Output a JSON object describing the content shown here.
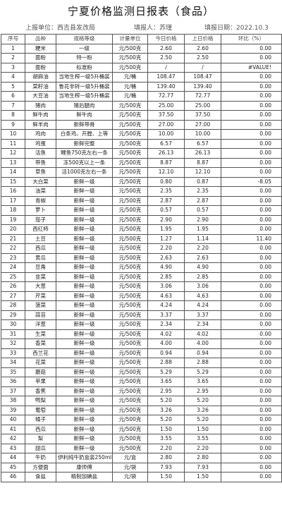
{
  "title": "宁夏价格监测日报表（食品）",
  "meta": {
    "unit_label": "上报单位：",
    "unit_value": "西吉县发改局",
    "reporter_label": "填报人：",
    "reporter_value": "苏瑾",
    "date_label": "填报日期：",
    "date_value": "2022.10.3"
  },
  "columns": [
    "序号",
    "品种",
    "规格等级",
    "计量单位",
    "今日价格",
    "上日价格",
    "环比（%）"
  ],
  "rows": [
    [
      "1",
      "粳米",
      "一级",
      "元/500克",
      "2.60",
      "2.60",
      "0.00"
    ],
    [
      "2",
      "面粉",
      "特一粉",
      "元/500克",
      "2.50",
      "2.50",
      "0.00"
    ],
    [
      "3",
      "面粉",
      "标准粉",
      "元/500克",
      "/",
      "/",
      "#VALUE!"
    ],
    [
      "4",
      "胡麻油",
      "当地生榨一级5升桶装",
      "元/桶",
      "108.47",
      "108.47",
      "0.00"
    ],
    [
      "5",
      "菜籽油",
      "鲁花非转一级5升桶装",
      "元/桶",
      "139.40",
      "139.40",
      "0.00"
    ],
    [
      "6",
      "大豆油",
      "当地生榨一级5升桶装",
      "元/桶",
      "72.77",
      "72.77",
      "0.00"
    ],
    [
      "7",
      "猪肉",
      "猪后腿肉",
      "元/500克",
      "25.00",
      "25.00",
      "0.00"
    ],
    [
      "8",
      "鲜牛肉",
      "鲜牛肉",
      "元/500克",
      "37.50",
      "37.50",
      "0.00"
    ],
    [
      "9",
      "鲜羊肉",
      "新鲜带骨",
      "元/500克",
      "27.00",
      "27.00",
      "0.00"
    ],
    [
      "10",
      "鸡肉",
      "白条鸡、开膛、上等",
      "元/500克",
      "10.00",
      "10.00",
      "0.00"
    ],
    [
      "11",
      "鸡蛋",
      "新鲜完整",
      "元/500克",
      "6.57",
      "6.57",
      "0.00"
    ],
    [
      "12",
      "活鱼",
      "鲤鱼750克左右一条",
      "元/500克",
      "26.13",
      "26.13",
      "0.00"
    ],
    [
      "13",
      "带鱼",
      "冻500克以上一条",
      "元/500克",
      "8.87",
      "8.87",
      "0.00"
    ],
    [
      "14",
      "草鱼",
      "活1000克左右一条",
      "元/500克",
      "12.10",
      "12.10",
      "0.00"
    ],
    [
      "15",
      "大白菜",
      "新鲜一级",
      "元/500克",
      "0.80",
      "0.87",
      "-8.05"
    ],
    [
      "16",
      "油菜",
      "新鲜一级",
      "元/500克",
      "2.35",
      "2.35",
      "0.00"
    ],
    [
      "17",
      "青椒",
      "新鲜一级",
      "元/500克",
      "2.87",
      "2.87",
      "0.00"
    ],
    [
      "18",
      "萝卜",
      "新鲜一级",
      "元/500克",
      "0.57",
      "0.57",
      "0.00"
    ],
    [
      "19",
      "茄子",
      "新鲜一级",
      "元/500克",
      "2.90",
      "2.90",
      "0.00"
    ],
    [
      "20",
      "西红柿",
      "新鲜一级",
      "元/500克",
      "1.95",
      "1.95",
      "0.00"
    ],
    [
      "21",
      "土豆",
      "新鲜一级",
      "元/500克",
      "1.27",
      "1.14",
      "11.40"
    ],
    [
      "22",
      "西瓜",
      "新鲜一级",
      "元/500克",
      "2.20",
      "2.20",
      "0.00"
    ],
    [
      "23",
      "黄瓜",
      "新鲜一级",
      "元/500克",
      "2.63",
      "2.63",
      "0.00"
    ],
    [
      "24",
      "豆角",
      "新鲜一级",
      "元/500克",
      "4.90",
      "4.90",
      "0.00"
    ],
    [
      "25",
      "韭菜",
      "新鲜一级",
      "元/500克",
      "2.85",
      "2.85",
      "0.00"
    ],
    [
      "26",
      "大葱",
      "新鲜一级",
      "元/500克",
      "3.06",
      "3.06",
      "0.00"
    ],
    [
      "27",
      "芹菜",
      "新鲜一级",
      "元/500克",
      "4.63",
      "4.63",
      "0.00"
    ],
    [
      "28",
      "菠菜",
      "新鲜一级",
      "元/500克",
      "4.24",
      "4.24",
      "0.00"
    ],
    [
      "29",
      "蒜苔",
      "新鲜一级",
      "元/500克",
      "3.37",
      "3.37",
      "0.00"
    ],
    [
      "30",
      "洋葱",
      "新鲜一级",
      "元/500克",
      "2.34",
      "2.34",
      "0.00"
    ],
    [
      "31",
      "生菜",
      "新鲜一级",
      "元/500克",
      "4.02",
      "4.02",
      "0.00"
    ],
    [
      "32",
      "香菜",
      "新鲜一级",
      "元/500克",
      "4.00",
      "4.00",
      "0.00"
    ],
    [
      "33",
      "西兰花",
      "新鲜一级",
      "元/500克",
      "0.94",
      "0.94",
      "0.00"
    ],
    [
      "34",
      "花菜",
      "新鲜一级",
      "元/500克",
      "2.88",
      "2.88",
      "0.00"
    ],
    [
      "35",
      "蘑菇",
      "新鲜一级",
      "元/500克",
      "5.29",
      "5.29",
      "0.00"
    ],
    [
      "36",
      "苹果",
      "新鲜一级",
      "元/500克",
      "3.65",
      "3.65",
      "0.00"
    ],
    [
      "37",
      "香蕉",
      "新鲜一级",
      "元/500克",
      "2.95",
      "2.95",
      "0.00"
    ],
    [
      "38",
      "鸭梨",
      "新鲜一级",
      "元/500克",
      "5.20",
      "5.20",
      "0.00"
    ],
    [
      "39",
      "葡萄",
      "新鲜一级",
      "元/500克",
      "3.26",
      "3.26",
      "0.00"
    ],
    [
      "40",
      "橘子",
      "新鲜一级",
      "元/500克",
      "5.20",
      "5.20",
      "0.00"
    ],
    [
      "41",
      "西瓜",
      "新鲜一级",
      "元/500克",
      "1.50",
      "1.50",
      "0.00"
    ],
    [
      "42",
      "梨",
      "新鲜一级",
      "元/500克",
      "3.55",
      "3.55",
      "0.00"
    ],
    [
      "43",
      "甜瓜",
      "新鲜一级",
      "元/500克",
      "2.20",
      "2.20",
      "0.00"
    ],
    [
      "44",
      "牛奶",
      "伊利纯牛奶盒装250ml",
      "元/盒",
      "2.80",
      "2.80",
      "0.00"
    ],
    [
      "45",
      "方便面",
      "康师傅",
      "元/袋",
      "7.93",
      "7.93",
      "0.00"
    ],
    [
      "46",
      "食盐",
      "精制加碘盐",
      "元/袋",
      "1.50",
      "1.50",
      "0.00"
    ]
  ]
}
